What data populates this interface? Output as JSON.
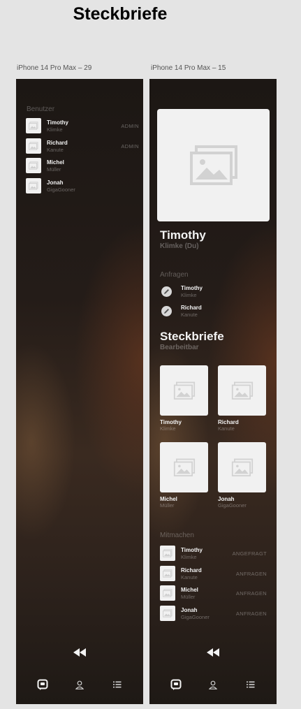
{
  "page": {
    "title": "Steckbriefe"
  },
  "frames": [
    {
      "label": "iPhone 14 Pro Max – 29"
    },
    {
      "label": "iPhone 14 Pro Max – 15"
    }
  ],
  "screen1": {
    "section_label": "Benutzer",
    "users": [
      {
        "first": "Timothy",
        "last": "Klimke",
        "role": "ADMIN"
      },
      {
        "first": "Richard",
        "last": "Kanute",
        "role": "ADMIN"
      },
      {
        "first": "Michel",
        "last": "Müller",
        "role": ""
      },
      {
        "first": "Jonah",
        "last": "GigaGooner",
        "role": ""
      }
    ]
  },
  "screen2": {
    "profile": {
      "name": "Timothy",
      "sub": "Klimke (Du)"
    },
    "requests_label": "Anfragen",
    "requests": [
      {
        "first": "Timothy",
        "last": "Klimke"
      },
      {
        "first": "Richard",
        "last": "Kanute"
      }
    ],
    "steckbriefe_title": "Steckbriefe",
    "steckbriefe_sub": "Bearbeitbar",
    "cards": [
      {
        "first": "Timothy",
        "last": "Klimke"
      },
      {
        "first": "Richard",
        "last": "Kanute"
      },
      {
        "first": "Michel",
        "last": "Müller"
      },
      {
        "first": "Jonah",
        "last": "GigaGooner"
      }
    ],
    "join_label": "Mitmachen",
    "join": [
      {
        "first": "Timothy",
        "last": "Klimke",
        "action": "ANGEFRAGT"
      },
      {
        "first": "Richard",
        "last": "Kanute",
        "action": "ANFRAGEN"
      },
      {
        "first": "Michel",
        "last": "Müller",
        "action": "ANFRAGEN"
      },
      {
        "first": "Jonah",
        "last": "GigaGooner",
        "action": "ANFRAGEN"
      }
    ]
  },
  "icons": {
    "back": "rewind-icon",
    "nav": [
      "chat-icon",
      "profile-icon",
      "list-icon"
    ],
    "image": "image-placeholder-icon",
    "edit": "edit-pencil-icon"
  },
  "colors": {
    "accent": "#f3f3f3",
    "muted": "#7c7470",
    "placeholder": "#f1f1f1"
  }
}
